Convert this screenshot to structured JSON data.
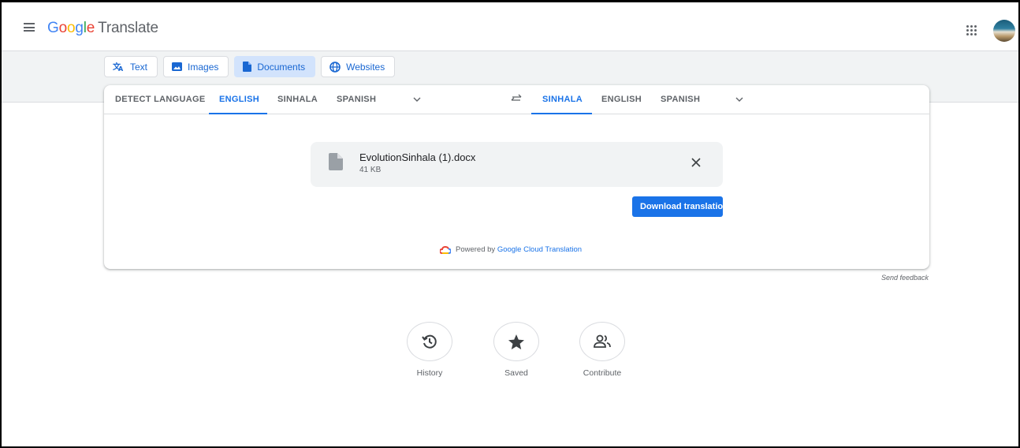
{
  "app": {
    "logo_google": "Google",
    "logo_word": "Translate"
  },
  "modes": [
    {
      "label": "Text",
      "icon": "translate-icon",
      "active": false
    },
    {
      "label": "Images",
      "icon": "image-icon",
      "active": false
    },
    {
      "label": "Documents",
      "icon": "document-icon",
      "active": true
    },
    {
      "label": "Websites",
      "icon": "globe-icon",
      "active": false
    }
  ],
  "source_langs": {
    "detect": "DETECT LANGUAGE",
    "l1": "ENGLISH",
    "l2": "SINHALA",
    "l3": "SPANISH",
    "selected": "ENGLISH"
  },
  "target_langs": {
    "l1": "SINHALA",
    "l2": "ENGLISH",
    "l3": "SPANISH",
    "selected": "SINHALA"
  },
  "file": {
    "name": "EvolutionSinhala (1).docx",
    "size": "41 KB"
  },
  "download_label": "Download translation",
  "powered": {
    "prefix": "Powered by",
    "link": "Google Cloud Translation"
  },
  "feedback_label": "Send feedback",
  "actions": [
    {
      "label": "History",
      "icon": "history-icon"
    },
    {
      "label": "Saved",
      "icon": "star-icon"
    },
    {
      "label": "Contribute",
      "icon": "people-icon"
    }
  ],
  "colors": {
    "accent": "#1a73e8",
    "active_tab_bg": "#d2e3fc",
    "strip_bg": "#f1f3f4"
  }
}
